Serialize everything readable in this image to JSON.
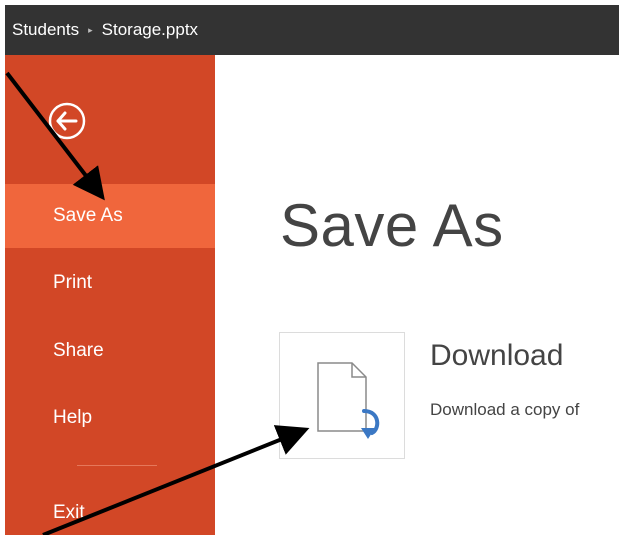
{
  "titlebar": {
    "breadcrumb": [
      "Students",
      "Storage.pptx"
    ],
    "separator": "▸"
  },
  "sidebar": {
    "back_icon": "back-arrow-circle-icon",
    "items": [
      {
        "label": "Save As",
        "active": true
      },
      {
        "label": "Print",
        "active": false
      },
      {
        "label": "Share",
        "active": false
      },
      {
        "label": "Help",
        "active": false
      },
      {
        "label": "Exit",
        "active": false
      }
    ]
  },
  "main": {
    "title": "Save As",
    "download": {
      "icon": "download-document-icon",
      "title": "Download",
      "description": "Download a copy of"
    }
  },
  "colors": {
    "titlebar": "#333333",
    "sidebar": "#d24726",
    "sidebar_active": "#f0663c",
    "download_arrow": "#3b78c4",
    "annotation_arrow": "#000000"
  },
  "annotations": {
    "arrows": [
      "pointer-to-save-as",
      "pointer-to-download-icon"
    ]
  }
}
